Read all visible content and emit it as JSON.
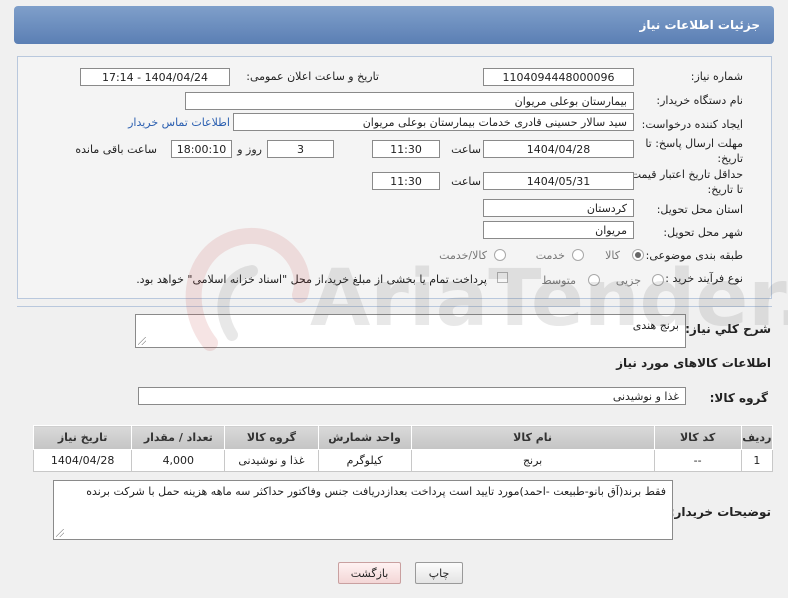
{
  "header": {
    "title": "جزئیات اطلاعات نیاز"
  },
  "fields": {
    "need_number_label": "شماره نیاز:",
    "need_number": "1104094448000096",
    "announce_label": "تاریخ و ساعت اعلان عمومی:",
    "announce_value": "1404/04/24 - 17:14",
    "buyer_org_label": "نام دستگاه خریدار:",
    "buyer_org": "بیمارستان بوعلی مریوان",
    "creator_label": "ایجاد کننده درخواست:",
    "creator": "سید سالار حسینی قادری خدمات بیمارستان بوعلی مریوان",
    "contact_link": "اطلاعات تماس خریدار",
    "deadline_label": "مهلت ارسال پاسخ: تا تاریخ:",
    "deadline_date": "1404/04/28",
    "time_label": "ساعت",
    "deadline_time": "11:30",
    "days_value": "3",
    "days_label": "روز و",
    "remaining_time": "18:00:10",
    "remaining_label": "ساعت باقی مانده",
    "validity_label": "حداقل تاریخ اعتبار قیمت: تا تاریخ:",
    "validity_date": "1404/05/31",
    "validity_time": "11:30",
    "province_label": "استان محل تحویل:",
    "province": "کردستان",
    "city_label": "شهر محل تحویل:",
    "city": "مریوان",
    "category_label": "طبقه بندی موضوعی:",
    "category_options": [
      "کالا",
      "خدمت",
      "کالا/خدمت"
    ],
    "process_label": "نوع فرآیند خرید :",
    "process_options": [
      "جزیی",
      "متوسط"
    ],
    "payment_note": "پرداخت تمام یا بخشی از مبلغ خرید،از محل \"اسناد خزانه اسلامی\" خواهد بود."
  },
  "summary": {
    "label": "شرح کلي نياز:",
    "value": "برنج هندی"
  },
  "goods": {
    "section_title": "اطلاعات کالاهای مورد نیاز",
    "group_label": "گروه کالا:",
    "group_value": "غذا و نوشیدنی",
    "columns": [
      "ردیف",
      "کد کالا",
      "نام کالا",
      "واحد شمارش",
      "گروه کالا",
      "تعداد / مقدار",
      "تاریخ نیاز"
    ],
    "rows": [
      [
        "1",
        "--",
        "برنج",
        "کیلوگرم",
        "غذا و نوشیدنی",
        "4,000",
        "1404/04/28"
      ]
    ]
  },
  "notes": {
    "label": "توضیحات خریدار:",
    "value": "فقط برند(آق بانو-طبیعت -احمد)مورد تایید است پرداخت بعدازدریافت جنس وفاکتور حداکثر سه ماهه هزینه حمل با شرکت برنده"
  },
  "buttons": {
    "print": "چاپ",
    "back": "بازگشت"
  },
  "watermark": {
    "text": "AriaTender.net"
  }
}
